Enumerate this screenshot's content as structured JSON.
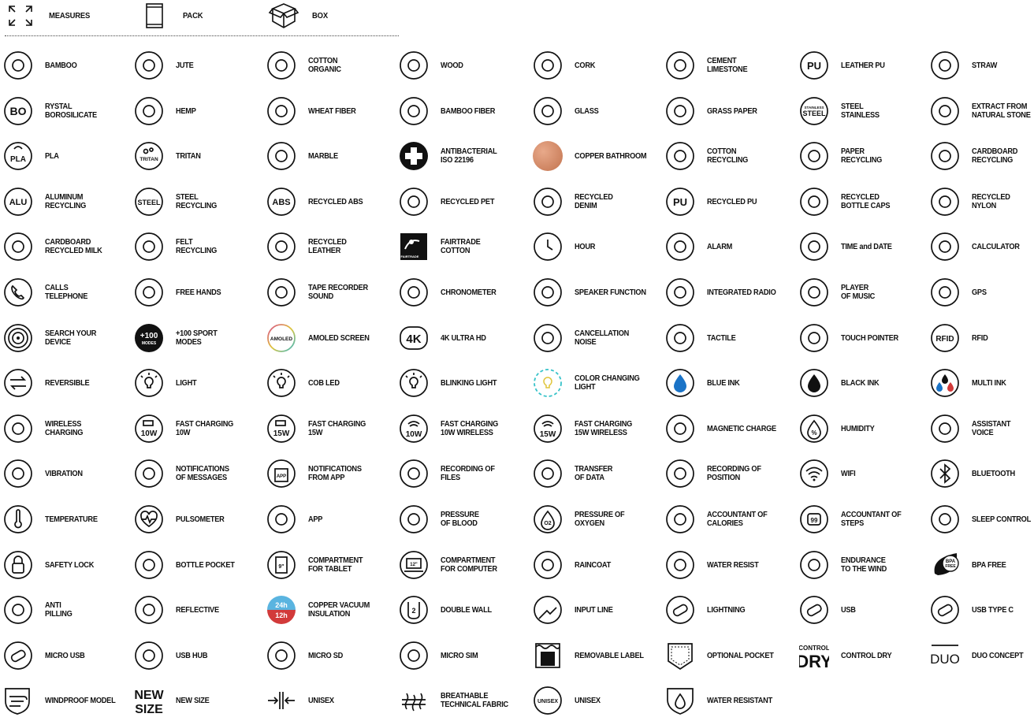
{
  "header": [
    {
      "label": "MEASURES",
      "icon": "measures-icon"
    },
    {
      "label": "PACK",
      "icon": "pack-icon"
    },
    {
      "label": "BOX",
      "icon": "box-icon"
    }
  ],
  "colors": {
    "ink": "#111111",
    "copper": "#c77a56",
    "blue": "#1a73c7",
    "red": "#d23a3a",
    "teal": "#36c2c9",
    "amoled_gradient": [
      "#d84a8e",
      "#e0c53a",
      "#37b7c9"
    ]
  },
  "rows": [
    [
      {
        "lines": [
          "BAMBOO"
        ],
        "icon": "bamboo-icon",
        "t": ""
      },
      {
        "lines": [
          "JUTE"
        ],
        "icon": "jute-icon",
        "t": ""
      },
      {
        "lines": [
          "COTTON",
          "ORGANIC"
        ],
        "icon": "cotton-organic-icon",
        "t": ""
      },
      {
        "lines": [
          "WOOD"
        ],
        "icon": "wood-icon",
        "t": ""
      },
      {
        "lines": [
          "CORK"
        ],
        "icon": "cork-icon",
        "t": ""
      },
      {
        "lines": [
          "CEMENT",
          "LIMESTONE"
        ],
        "icon": "cement-limestone-icon",
        "t": ""
      },
      {
        "lines": [
          "LEATHER PU"
        ],
        "icon": "leather-pu-icon",
        "t": "PU"
      },
      {
        "lines": [
          "STRAW"
        ],
        "icon": "straw-icon",
        "t": ""
      }
    ],
    [
      {
        "lines": [
          "RYSTAL",
          "BOROSILICATE"
        ],
        "icon": "borosilicate-icon",
        "t": "BO"
      },
      {
        "lines": [
          "HEMP"
        ],
        "icon": "hemp-icon",
        "t": ""
      },
      {
        "lines": [
          "WHEAT FIBER"
        ],
        "icon": "wheat-fiber-icon",
        "t": ""
      },
      {
        "lines": [
          "BAMBOO FIBER"
        ],
        "icon": "bamboo-fiber-icon",
        "t": ""
      },
      {
        "lines": [
          "GLASS"
        ],
        "icon": "glass-icon",
        "t": ""
      },
      {
        "lines": [
          "GRASS PAPER"
        ],
        "icon": "grass-paper-icon",
        "t": ""
      },
      {
        "lines": [
          "STEEL",
          "STAINLESS"
        ],
        "icon": "steel-stainless-icon",
        "t": "STEEL"
      },
      {
        "lines": [
          "EXTRACT FROM",
          "NATURAL STONE"
        ],
        "icon": "natural-stone-icon",
        "t": ""
      }
    ],
    [
      {
        "lines": [
          "PLA"
        ],
        "icon": "pla-icon",
        "t": "PLA"
      },
      {
        "lines": [
          "TRITAN"
        ],
        "icon": "tritan-icon",
        "t": "TRITAN"
      },
      {
        "lines": [
          "MARBLE"
        ],
        "icon": "marble-icon",
        "t": ""
      },
      {
        "lines": [
          "ANTIBACTERIAL",
          "ISO 22196"
        ],
        "icon": "antibacterial-icon",
        "t": ""
      },
      {
        "lines": [
          "COPPER BATHROOM"
        ],
        "icon": "copper-bathroom-icon",
        "t": ""
      },
      {
        "lines": [
          "COTTON",
          "RECYCLING"
        ],
        "icon": "cotton-recycling-icon",
        "t": ""
      },
      {
        "lines": [
          "PAPER",
          "RECYCLING"
        ],
        "icon": "paper-recycling-icon",
        "t": ""
      },
      {
        "lines": [
          "CARDBOARD",
          "RECYCLING"
        ],
        "icon": "cardboard-recycling-icon",
        "t": ""
      }
    ],
    [
      {
        "lines": [
          "ALUMINUM",
          "RECYCLING"
        ],
        "icon": "aluminum-recycling-icon",
        "t": "ALU"
      },
      {
        "lines": [
          "STEEL",
          "RECYCLING"
        ],
        "icon": "steel-recycling-icon",
        "t": "STEEL"
      },
      {
        "lines": [
          "RECYCLED ABS"
        ],
        "icon": "recycled-abs-icon",
        "t": "ABS"
      },
      {
        "lines": [
          "RECYCLED PET"
        ],
        "icon": "recycled-pet-icon",
        "t": ""
      },
      {
        "lines": [
          "RECYCLED",
          "DENIM"
        ],
        "icon": "recycled-denim-icon",
        "t": ""
      },
      {
        "lines": [
          "RECYCLED PU"
        ],
        "icon": "recycled-pu-icon",
        "t": "PU"
      },
      {
        "lines": [
          "RECYCLED",
          "BOTTLE CAPS"
        ],
        "icon": "recycled-bottle-caps-icon",
        "t": ""
      },
      {
        "lines": [
          "RECYCLED",
          "NYLON"
        ],
        "icon": "recycled-nylon-icon",
        "t": ""
      }
    ],
    [
      {
        "lines": [
          "CARDBOARD",
          "RECYCLED MILK"
        ],
        "icon": "cardboard-recycled-milk-icon",
        "t": ""
      },
      {
        "lines": [
          "FELT",
          "RECYCLING"
        ],
        "icon": "felt-recycling-icon",
        "t": ""
      },
      {
        "lines": [
          "RECYCLED",
          "LEATHER"
        ],
        "icon": "recycled-leather-icon",
        "t": ""
      },
      {
        "lines": [
          "FAIRTRADE",
          "COTTON"
        ],
        "icon": "fairtrade-cotton-icon",
        "t": "FAIRTRADE"
      },
      {
        "lines": [
          "HOUR"
        ],
        "icon": "clock-icon",
        "t": ""
      },
      {
        "lines": [
          "ALARM"
        ],
        "icon": "alarm-icon",
        "t": ""
      },
      {
        "lines": [
          "TIME and DATE"
        ],
        "icon": "calendar-icon",
        "t": ""
      },
      {
        "lines": [
          "CALCULATOR"
        ],
        "icon": "calculator-icon",
        "t": ""
      }
    ],
    [
      {
        "lines": [
          "CALLS",
          "TELEPHONE"
        ],
        "icon": "phone-icon",
        "t": ""
      },
      {
        "lines": [
          "FREE HANDS"
        ],
        "icon": "headset-icon",
        "t": ""
      },
      {
        "lines": [
          "TAPE RECORDER",
          "SOUND"
        ],
        "icon": "microphone-icon",
        "t": ""
      },
      {
        "lines": [
          "CHRONOMETER"
        ],
        "icon": "stopwatch-icon",
        "t": ""
      },
      {
        "lines": [
          "SPEAKER FUNCTION"
        ],
        "icon": "speaker-icon",
        "t": ""
      },
      {
        "lines": [
          "INTEGRATED RADIO"
        ],
        "icon": "radio-icon",
        "t": ""
      },
      {
        "lines": [
          "PLAYER",
          "OF MUSIC"
        ],
        "icon": "music-player-icon",
        "t": ""
      },
      {
        "lines": [
          "GPS"
        ],
        "icon": "gps-icon",
        "t": ""
      }
    ],
    [
      {
        "lines": [
          "SEARCH YOUR",
          "DEVICE"
        ],
        "icon": "search-device-icon",
        "t": ""
      },
      {
        "lines": [
          "+100 SPORT",
          "MODES"
        ],
        "icon": "sport-modes-icon",
        "t": "+100"
      },
      {
        "lines": [
          "AMOLED SCREEN"
        ],
        "icon": "amoled-icon",
        "t": "AMOLED"
      },
      {
        "lines": [
          "4K ULTRA HD"
        ],
        "icon": "4k-icon",
        "t": "4K"
      },
      {
        "lines": [
          "CANCELLATION",
          "NOISE"
        ],
        "icon": "noise-cancel-icon",
        "t": ""
      },
      {
        "lines": [
          "TACTILE"
        ],
        "icon": "tactile-icon",
        "t": ""
      },
      {
        "lines": [
          "TOUCH POINTER"
        ],
        "icon": "touch-pointer-icon",
        "t": ""
      },
      {
        "lines": [
          "RFID"
        ],
        "icon": "rfid-icon",
        "t": "RFID"
      }
    ],
    [
      {
        "lines": [
          "REVERSIBLE"
        ],
        "icon": "reversible-icon",
        "t": ""
      },
      {
        "lines": [
          "LIGHT"
        ],
        "icon": "light-icon",
        "t": ""
      },
      {
        "lines": [
          "COB LED"
        ],
        "icon": "cob-led-icon",
        "t": ""
      },
      {
        "lines": [
          "BLINKING LIGHT"
        ],
        "icon": "blinking-light-icon",
        "t": ""
      },
      {
        "lines": [
          "COLOR CHANGING",
          "LIGHT"
        ],
        "icon": "color-light-icon",
        "t": ""
      },
      {
        "lines": [
          "BLUE INK"
        ],
        "icon": "blue-ink-icon",
        "t": ""
      },
      {
        "lines": [
          "BLACK INK"
        ],
        "icon": "black-ink-icon",
        "t": ""
      },
      {
        "lines": [
          "MULTI INK"
        ],
        "icon": "multi-ink-icon",
        "t": ""
      }
    ],
    [
      {
        "lines": [
          "WIRELESS",
          "CHARGING"
        ],
        "icon": "wireless-charging-icon",
        "t": ""
      },
      {
        "lines": [
          "FAST CHARGING",
          "10W"
        ],
        "icon": "fast-charging-10w-icon",
        "t": "10W"
      },
      {
        "lines": [
          "FAST CHARGING",
          "15W"
        ],
        "icon": "fast-charging-15w-icon",
        "t": "15W"
      },
      {
        "lines": [
          "FAST CHARGING",
          "10W WIRELESS"
        ],
        "icon": "wireless-10w-icon",
        "t": "10W"
      },
      {
        "lines": [
          "FAST CHARGING",
          "15W WIRELESS"
        ],
        "icon": "wireless-15w-icon",
        "t": "15W"
      },
      {
        "lines": [
          "MAGNETIC CHARGE"
        ],
        "icon": "magnetic-icon",
        "t": ""
      },
      {
        "lines": [
          "HUMIDITY"
        ],
        "icon": "humidity-icon",
        "t": "%"
      },
      {
        "lines": [
          "ASSISTANT",
          "VOICE"
        ],
        "icon": "voice-assistant-icon",
        "t": ""
      }
    ],
    [
      {
        "lines": [
          "VIBRATION"
        ],
        "icon": "vibration-icon",
        "t": ""
      },
      {
        "lines": [
          "NOTIFICATIONS",
          "OF MESSAGES"
        ],
        "icon": "notification-icon",
        "t": ""
      },
      {
        "lines": [
          "NOTIFICATIONS",
          "FROM APP"
        ],
        "icon": "app-notification-icon",
        "t": "APP"
      },
      {
        "lines": [
          "RECORDING OF",
          "FILES"
        ],
        "icon": "files-icon",
        "t": ""
      },
      {
        "lines": [
          "TRANSFER",
          "OF DATA"
        ],
        "icon": "data-transfer-icon",
        "t": ""
      },
      {
        "lines": [
          "RECORDING OF",
          "POSITION"
        ],
        "icon": "position-icon",
        "t": ""
      },
      {
        "lines": [
          "WIFI"
        ],
        "icon": "wifi-icon",
        "t": ""
      },
      {
        "lines": [
          "BLUETOOTH"
        ],
        "icon": "bluetooth-icon",
        "t": ""
      }
    ],
    [
      {
        "lines": [
          "TEMPERATURE"
        ],
        "icon": "thermometer-icon",
        "t": ""
      },
      {
        "lines": [
          "PULSOMETER"
        ],
        "icon": "heart-rate-icon",
        "t": ""
      },
      {
        "lines": [
          "APP"
        ],
        "icon": "app-icon",
        "t": ""
      },
      {
        "lines": [
          "PRESSURE",
          "OF BLOOD"
        ],
        "icon": "blood-pressure-icon",
        "t": ""
      },
      {
        "lines": [
          "PRESSURE OF",
          "OXYGEN"
        ],
        "icon": "oxygen-icon",
        "t": "O2"
      },
      {
        "lines": [
          "ACCOUNTANT OF",
          "CALORIES"
        ],
        "icon": "calories-icon",
        "t": ""
      },
      {
        "lines": [
          "ACCOUNTANT OF",
          "STEPS"
        ],
        "icon": "steps-icon",
        "t": "99"
      },
      {
        "lines": [
          "SLEEP CONTROL"
        ],
        "icon": "sleep-icon",
        "t": ""
      }
    ],
    [
      {
        "lines": [
          "SAFETY LOCK"
        ],
        "icon": "lock-icon",
        "t": ""
      },
      {
        "lines": [
          "BOTTLE POCKET"
        ],
        "icon": "bottle-pocket-icon",
        "t": ""
      },
      {
        "lines": [
          "COMPARTMENT",
          "FOR TABLET"
        ],
        "icon": "tablet-icon",
        "t": "9\""
      },
      {
        "lines": [
          "COMPARTMENT",
          "FOR COMPUTER"
        ],
        "icon": "laptop-icon",
        "t": "12\""
      },
      {
        "lines": [
          "RAINCOAT"
        ],
        "icon": "raincoat-icon",
        "t": ""
      },
      {
        "lines": [
          "WATER RESIST"
        ],
        "icon": "water-resist-icon",
        "t": ""
      },
      {
        "lines": [
          "ENDURANCE",
          "TO THE WIND"
        ],
        "icon": "wind-icon",
        "t": ""
      },
      {
        "lines": [
          "BPA FREE"
        ],
        "icon": "bpa-free-icon",
        "t": "BPA"
      }
    ],
    [
      {
        "lines": [
          "ANTI",
          "PILLING"
        ],
        "icon": "anti-pilling-icon",
        "t": ""
      },
      {
        "lines": [
          "REFLECTIVE"
        ],
        "icon": "reflective-icon",
        "t": ""
      },
      {
        "lines": [
          "COPPER VACUUM",
          "INSULATION"
        ],
        "icon": "copper-vacuum-icon",
        "t": "24h"
      },
      {
        "lines": [
          "DOUBLE WALL"
        ],
        "icon": "double-wall-icon",
        "t": "2"
      },
      {
        "lines": [
          "INPUT LINE"
        ],
        "icon": "jack-icon",
        "t": ""
      },
      {
        "lines": [
          "LIGHTNING"
        ],
        "icon": "lightning-cable-icon",
        "t": ""
      },
      {
        "lines": [
          "USB"
        ],
        "icon": "usb-icon",
        "t": ""
      },
      {
        "lines": [
          "USB TYPE C"
        ],
        "icon": "usb-c-icon",
        "t": ""
      }
    ],
    [
      {
        "lines": [
          "MICRO USB"
        ],
        "icon": "micro-usb-icon",
        "t": ""
      },
      {
        "lines": [
          "USB HUB"
        ],
        "icon": "usb-hub-icon",
        "t": ""
      },
      {
        "lines": [
          "MICRO SD"
        ],
        "icon": "micro-sd-icon",
        "t": ""
      },
      {
        "lines": [
          "MICRO SIM"
        ],
        "icon": "micro-sim-icon",
        "t": ""
      },
      {
        "lines": [
          "REMOVABLE LABEL"
        ],
        "icon": "removable-label-icon",
        "t": ""
      },
      {
        "lines": [
          "OPTIONAL POCKET"
        ],
        "icon": "pocket-icon",
        "t": ""
      },
      {
        "lines": [
          "CONTROL DRY"
        ],
        "icon": "control-dry-icon",
        "t": "CONTROL DRY"
      },
      {
        "lines": [
          "DUO CONCEPT"
        ],
        "icon": "duo-icon",
        "t": "DUO"
      }
    ],
    [
      {
        "lines": [
          "WINDPROOF MODEL"
        ],
        "icon": "windproof-icon",
        "t": ""
      },
      {
        "lines": [
          "NEW SIZE"
        ],
        "icon": "new-size-icon",
        "t": "NEW SIZE"
      },
      {
        "lines": [
          "UNISEX"
        ],
        "icon": "unisex-arrows-icon",
        "t": ""
      },
      {
        "lines": [
          "BREATHABLE",
          "TECHNICAL FABRIC"
        ],
        "icon": "breathable-icon",
        "t": ""
      },
      {
        "lines": [
          "UNISEX"
        ],
        "icon": "unisex-badge-icon",
        "t": "UNISEX"
      },
      {
        "lines": [
          "WATER RESISTANT"
        ],
        "icon": "water-resistant-icon",
        "t": ""
      }
    ]
  ]
}
